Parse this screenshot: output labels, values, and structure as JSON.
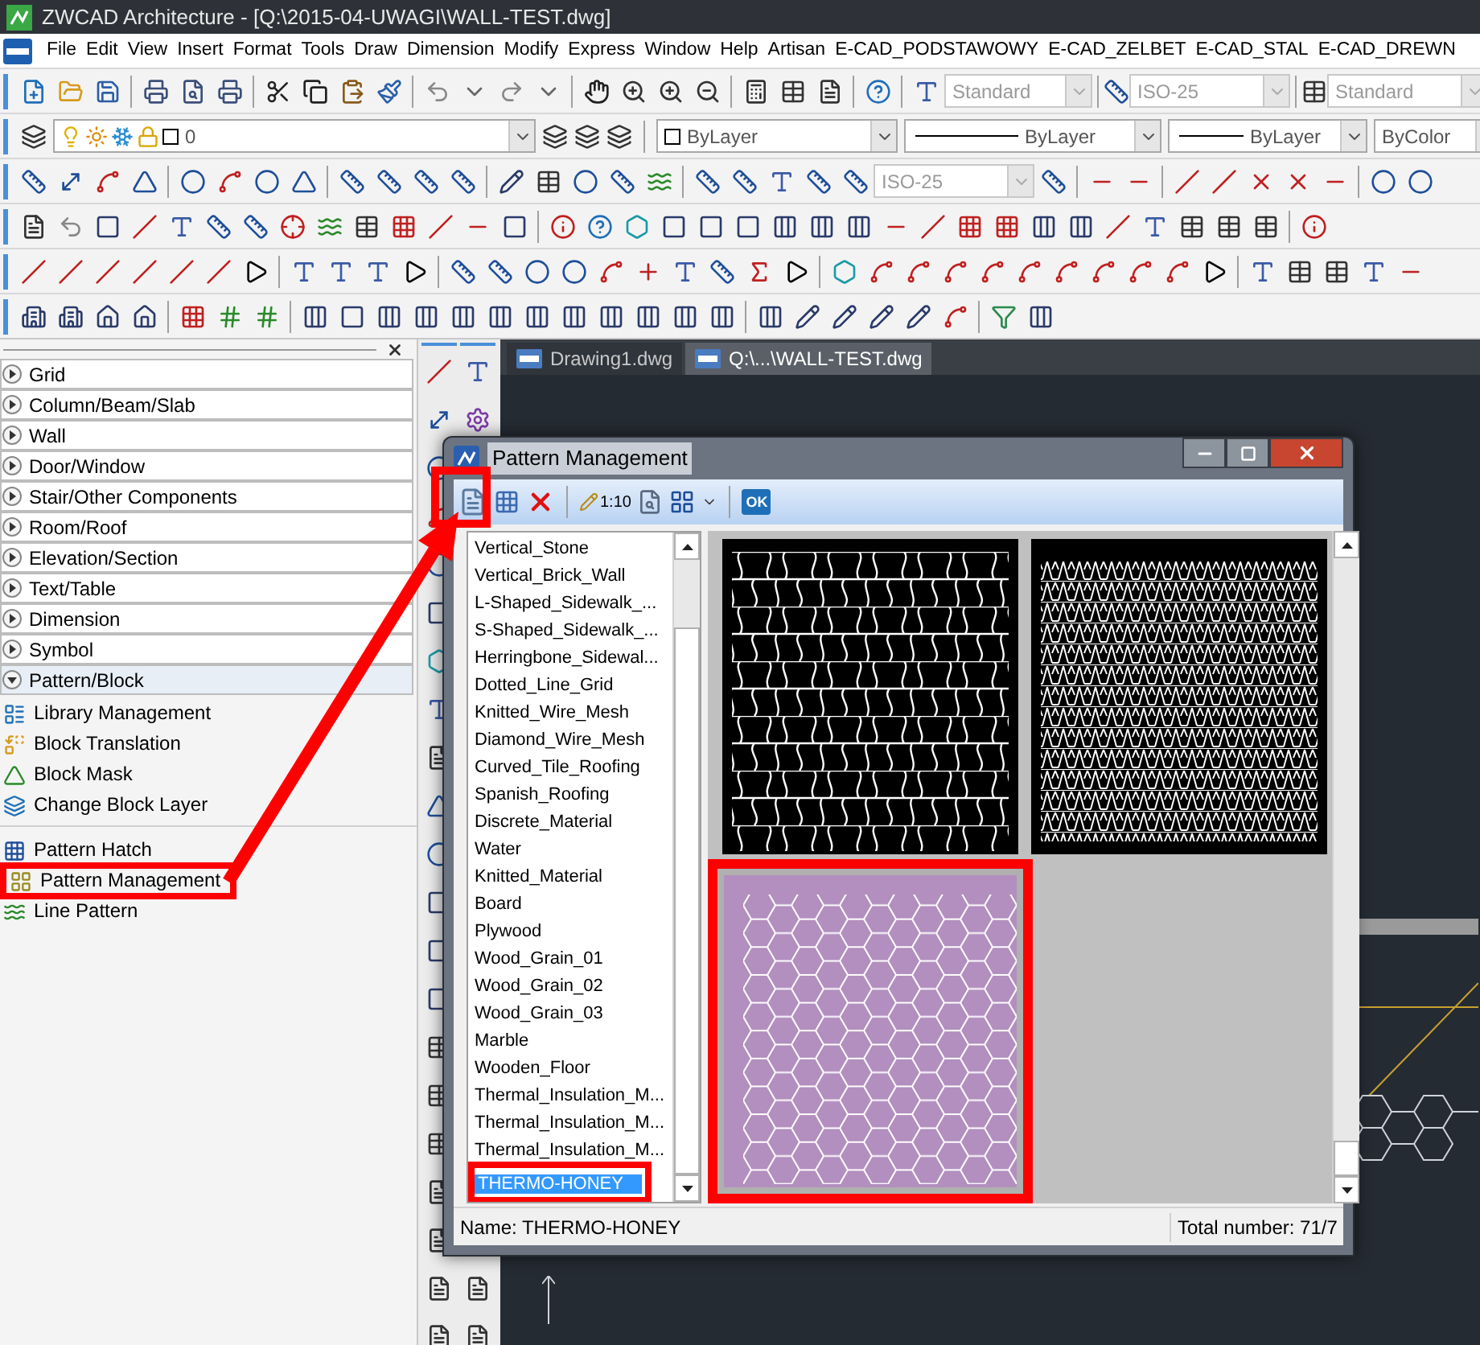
{
  "window": {
    "title": "ZWCAD Architecture - [Q:\\2015-04-UWAGI\\WALL-TEST.dwg]"
  },
  "menu": [
    "File",
    "Edit",
    "View",
    "Insert",
    "Format",
    "Tools",
    "Draw",
    "Dimension",
    "Modify",
    "Express",
    "Window",
    "Help",
    "Artisan",
    "E-CAD_PODSTAWOWY",
    "E-CAD_ZELBET",
    "E-CAD_STAL",
    "E-CAD_DREWN"
  ],
  "style_toolbar": {
    "text_style": "Standard",
    "dim_style": "ISO-25",
    "table_style": "Standard",
    "disabled": true
  },
  "layer_toolbar": {
    "layer": "0",
    "color_value": "ByLayer",
    "linetype": "ByLayer",
    "lineweight": "ByLayer",
    "plot_style": "ByColor"
  },
  "dimension_toolbar": {
    "dim_style": "ISO-25",
    "disabled": true
  },
  "panel": {
    "sections": [
      {
        "label": "Grid",
        "expanded": false
      },
      {
        "label": "Column/Beam/Slab",
        "expanded": false
      },
      {
        "label": "Wall",
        "expanded": false
      },
      {
        "label": "Door/Window",
        "expanded": false
      },
      {
        "label": "Stair/Other Components",
        "expanded": false
      },
      {
        "label": "Room/Roof",
        "expanded": false
      },
      {
        "label": "Elevation/Section",
        "expanded": false
      },
      {
        "label": "Text/Table",
        "expanded": false
      },
      {
        "label": "Dimension",
        "expanded": false
      },
      {
        "label": "Symbol",
        "expanded": false
      },
      {
        "label": "Pattern/Block",
        "expanded": true
      }
    ],
    "tool_groups": [
      [
        {
          "label": "Library Management",
          "highlighted": false
        },
        {
          "label": "Block Translation",
          "highlighted": false
        },
        {
          "label": "Block Mask",
          "highlighted": false
        },
        {
          "label": "Change Block Layer",
          "highlighted": false
        }
      ],
      [
        {
          "label": "Pattern Hatch",
          "highlighted": false
        },
        {
          "label": "Pattern Management",
          "highlighted": true
        },
        {
          "label": "Line Pattern",
          "highlighted": false
        }
      ]
    ]
  },
  "doc_tabs": [
    {
      "label": "Drawing1.dwg",
      "selected": false
    },
    {
      "label": "Q:\\...\\WALL-TEST.dwg",
      "selected": true
    }
  ],
  "dialog": {
    "title": "Pattern Management",
    "scale_text": "1:10",
    "ok_text": "OK",
    "patterns": [
      {
        "label": "Vertical_Stone",
        "selected": false,
        "highlighted": false
      },
      {
        "label": "Vertical_Brick_Wall",
        "selected": false,
        "highlighted": false
      },
      {
        "label": "L-Shaped_Sidewalk_...",
        "selected": false,
        "highlighted": false
      },
      {
        "label": "S-Shaped_Sidewalk_...",
        "selected": false,
        "highlighted": false
      },
      {
        "label": "Herringbone_Sidewal...",
        "selected": false,
        "highlighted": false
      },
      {
        "label": "Dotted_Line_Grid",
        "selected": false,
        "highlighted": false
      },
      {
        "label": "Knitted_Wire_Mesh",
        "selected": false,
        "highlighted": false
      },
      {
        "label": "Diamond_Wire_Mesh",
        "selected": false,
        "highlighted": false
      },
      {
        "label": "Curved_Tile_Roofing",
        "selected": false,
        "highlighted": false
      },
      {
        "label": "Spanish_Roofing",
        "selected": false,
        "highlighted": false
      },
      {
        "label": "Discrete_Material",
        "selected": false,
        "highlighted": false
      },
      {
        "label": "Water",
        "selected": false,
        "highlighted": false
      },
      {
        "label": "Knitted_Material",
        "selected": false,
        "highlighted": false
      },
      {
        "label": "Board",
        "selected": false,
        "highlighted": false
      },
      {
        "label": "Plywood",
        "selected": false,
        "highlighted": false
      },
      {
        "label": "Wood_Grain_01",
        "selected": false,
        "highlighted": false
      },
      {
        "label": "Wood_Grain_02",
        "selected": false,
        "highlighted": false
      },
      {
        "label": "Wood_Grain_03",
        "selected": false,
        "highlighted": false
      },
      {
        "label": "Marble",
        "selected": false,
        "highlighted": false
      },
      {
        "label": "Wooden_Floor",
        "selected": false,
        "highlighted": false
      },
      {
        "label": "Thermal_Insulation_M...",
        "selected": false,
        "highlighted": false
      },
      {
        "label": "Thermal_Insulation_M...",
        "selected": false,
        "highlighted": false
      },
      {
        "label": "Thermal_Insulation_M...",
        "selected": false,
        "highlighted": false
      },
      {
        "label": "THERMO-HONEY",
        "selected": true,
        "highlighted": true
      }
    ],
    "previews": [
      {
        "kind": "vase",
        "selected": false,
        "highlighted": false
      },
      {
        "kind": "mesh",
        "selected": false,
        "highlighted": false
      },
      {
        "kind": "honeycomb",
        "selected": true,
        "highlighted": true
      }
    ],
    "status_name": "Name: THERMO-HONEY",
    "status_total": "Total number: 71/7"
  }
}
